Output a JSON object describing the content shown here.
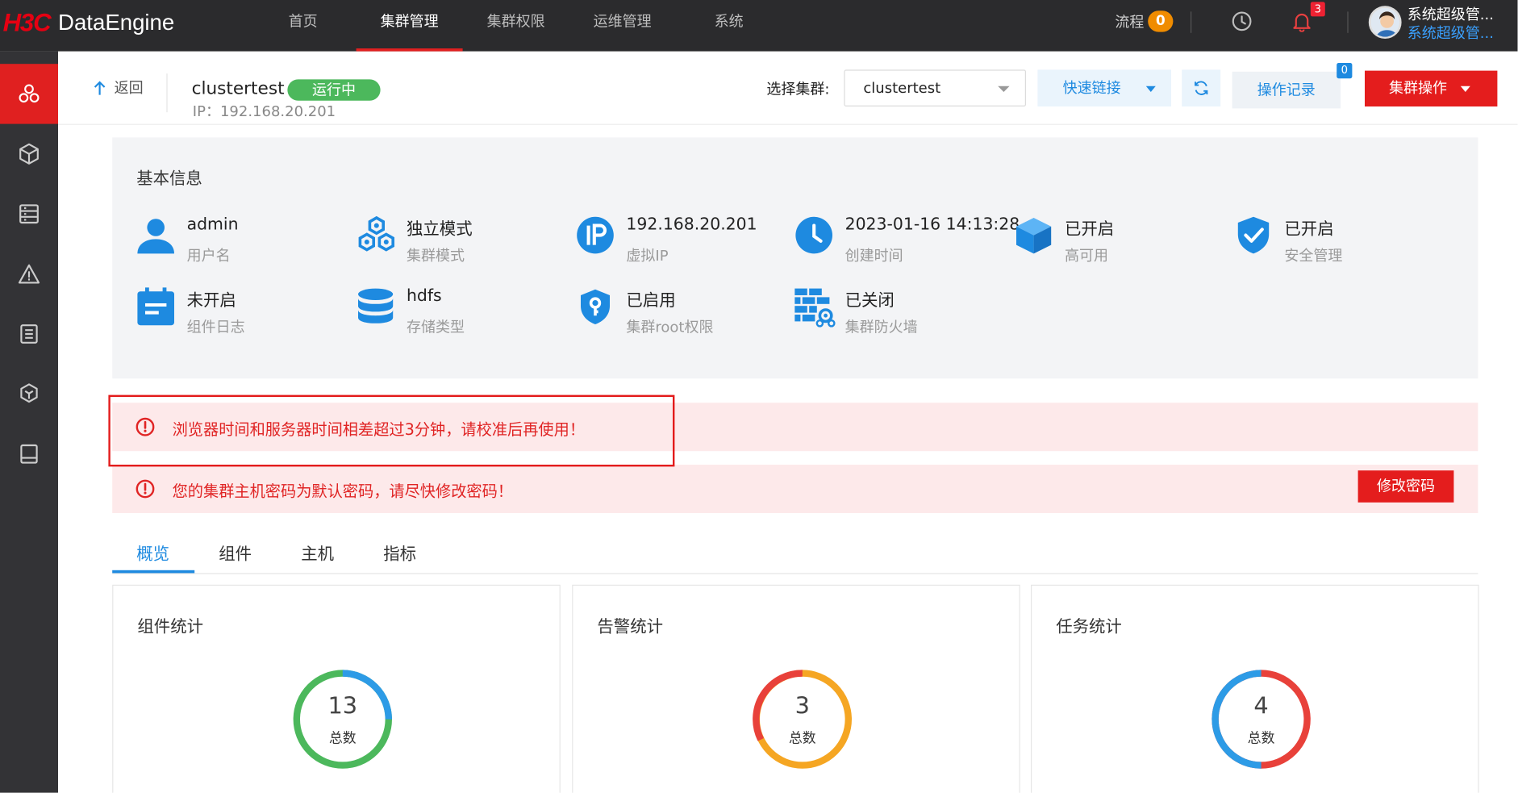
{
  "brand": {
    "logo_mark": "H3C",
    "product": "DataEngine"
  },
  "nav": {
    "items": [
      "首页",
      "集群管理",
      "集群权限",
      "运维管理",
      "系统"
    ],
    "active": 1
  },
  "topright": {
    "flow_label": "流程",
    "flow_count": "0",
    "bell_count": "3",
    "user_line1": "系统超级管...",
    "user_line2": "系统超级管..."
  },
  "sidebar": {
    "icons": [
      "cluster-icon",
      "box-icon",
      "server-list-icon",
      "warning-icon",
      "document-icon",
      "hexagon-layers-icon",
      "book-icon"
    ]
  },
  "header": {
    "back_label": "返回",
    "cluster_name": "clustertest",
    "status": "运行中",
    "ip_line": "IP：192.168.20.201",
    "select_label": "选择集群:",
    "select_value": "clustertest",
    "quick_link": "快速链接",
    "op_log": "操作记录",
    "op_log_badge": "0",
    "cluster_ops": "集群操作"
  },
  "basic_info": {
    "title": "基本信息",
    "items": [
      {
        "value": "admin",
        "label": "用户名",
        "icon": "user-icon"
      },
      {
        "value": "独立模式",
        "label": "集群模式",
        "icon": "hexagons-icon"
      },
      {
        "value": "192.168.20.201",
        "label": "虚拟IP",
        "icon": "ip-icon"
      },
      {
        "value": "2023-01-16 14:13:28",
        "label": "创建时间",
        "icon": "clock-icon"
      },
      {
        "value": "已开启",
        "label": "高可用",
        "icon": "cube-icon"
      },
      {
        "value": "已开启",
        "label": "安全管理",
        "icon": "shield-check-icon"
      },
      {
        "value": "未开启",
        "label": "组件日志",
        "icon": "calendar-log-icon"
      },
      {
        "value": "hdfs",
        "label": "存储类型",
        "icon": "database-icon"
      },
      {
        "value": "已启用",
        "label": "集群root权限",
        "icon": "shield-key-icon"
      },
      {
        "value": "已关闭",
        "label": "集群防火墙",
        "icon": "firewall-icon"
      }
    ]
  },
  "alerts": [
    {
      "text": "浏览器时间和服务器时间相差超过3分钟，请校准后再使用！"
    },
    {
      "text": "您的集群主机密码为默认密码，请尽快修改密码！",
      "button": "修改密码"
    }
  ],
  "tabs": {
    "items": [
      "概览",
      "组件",
      "主机",
      "指标"
    ],
    "active": 0
  },
  "cards": [
    {
      "title": "组件统计",
      "number": "13",
      "total_label": "总数"
    },
    {
      "title": "告警统计",
      "number": "3",
      "total_label": "总数"
    },
    {
      "title": "任务统计",
      "number": "4",
      "total_label": "总数"
    }
  ],
  "colors": {
    "accent_red": "#e41d1d",
    "accent_blue": "#1e8ae0",
    "green": "#4cb85c",
    "orange": "#f5a623"
  }
}
